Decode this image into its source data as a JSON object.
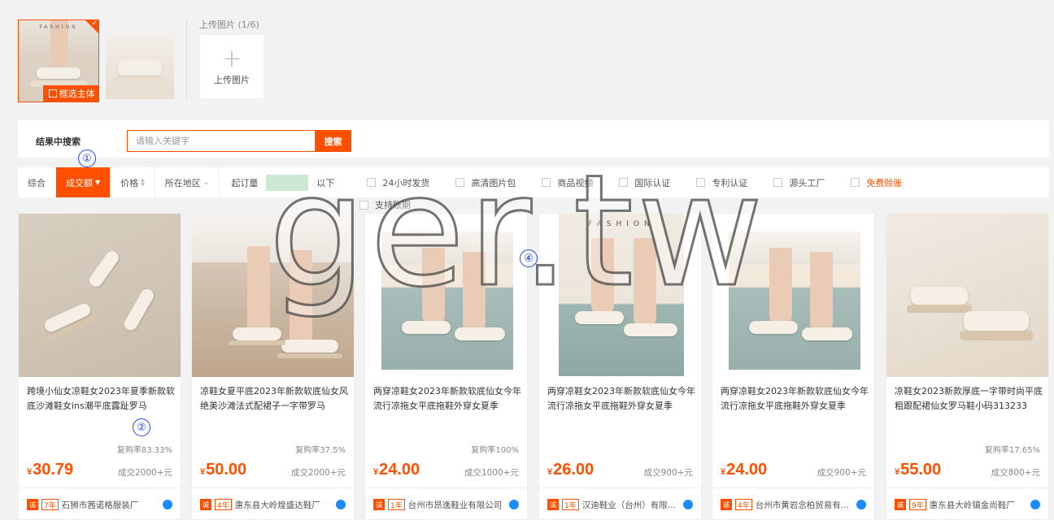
{
  "upload": {
    "thumb1_tag": "FASHION",
    "select_main_label": "框选主体",
    "title": "上传图片 (1/6)",
    "button_label": "上传图片"
  },
  "search": {
    "label": "结果中搜索",
    "placeholder": "请输入关键字",
    "button": "搜索"
  },
  "filters": {
    "items": [
      {
        "label": "综合"
      },
      {
        "label": "成交额"
      },
      {
        "label": "价格"
      },
      {
        "label": "所在地区"
      }
    ],
    "moq_label": "起订量",
    "moq_suffix": "以下",
    "checkboxes": [
      "24小时发货",
      "高清图片包",
      "商品视频",
      "国际认证",
      "专利认证",
      "源头工厂",
      "免费赊账"
    ],
    "second_line": "支持账期"
  },
  "products": [
    {
      "title": "跨境小仙女凉鞋女2023年夏季新款软底沙滩鞋女ins潮平底露趾罗马",
      "repurchase": "复购率83.33%",
      "currency": "¥",
      "price": "30.79",
      "sold": "成交2000+元",
      "years": "7年",
      "shop": "石狮市茜诺格服装厂"
    },
    {
      "title": "凉鞋女夏平底2023年新款软底仙女风绝美沙滩法式配裙子一字带罗马",
      "repurchase": "复购率37.5%",
      "currency": "¥",
      "price": "50.00",
      "sold": "成交2000+元",
      "years": "4年",
      "shop": "惠东县大岭煌盛达鞋厂"
    },
    {
      "title": "两穿凉鞋女2023年新款软底仙女今年流行凉拖女平底拖鞋外穿女夏季",
      "repurchase": "复购率100%",
      "currency": "¥",
      "price": "24.00",
      "sold": "成交1000+元",
      "years": "1年",
      "shop": "台州市昂逸鞋业有限公司"
    },
    {
      "title": "两穿凉鞋女2023年新款软底仙女今年流行凉拖女平底拖鞋外穿女夏季",
      "repurchase": "",
      "currency": "¥",
      "price": "26.00",
      "sold": "成交900+元",
      "years": "1年",
      "shop": "汉迪鞋业（台州）有限..."
    },
    {
      "title": "两穿凉鞋女2023年新款软底仙女今年流行凉拖女平底拖鞋外穿女夏季",
      "repurchase": "",
      "currency": "¥",
      "price": "24.00",
      "sold": "成交900+元",
      "years": "4年",
      "shop": "台州市黄岩念柏贸易有..."
    },
    {
      "title": "凉鞋女2023新款厚底一字带时尚平底粗跟配裙仙女罗马鞋小码313233",
      "repurchase": "复购率17.65%",
      "currency": "¥",
      "price": "55.00",
      "sold": "成交800+元",
      "years": "9年",
      "shop": "惠东县大岭镇金尚鞋厂"
    }
  ],
  "product_image_tag": "FASHION",
  "badge_glyph": "诚",
  "annotations": [
    "①",
    "②",
    "④"
  ],
  "watermark": "ger.tw",
  "colors": {
    "accent": "#ff5000",
    "annotation": "#2247e6",
    "moq_fill": "#cde8d2"
  }
}
